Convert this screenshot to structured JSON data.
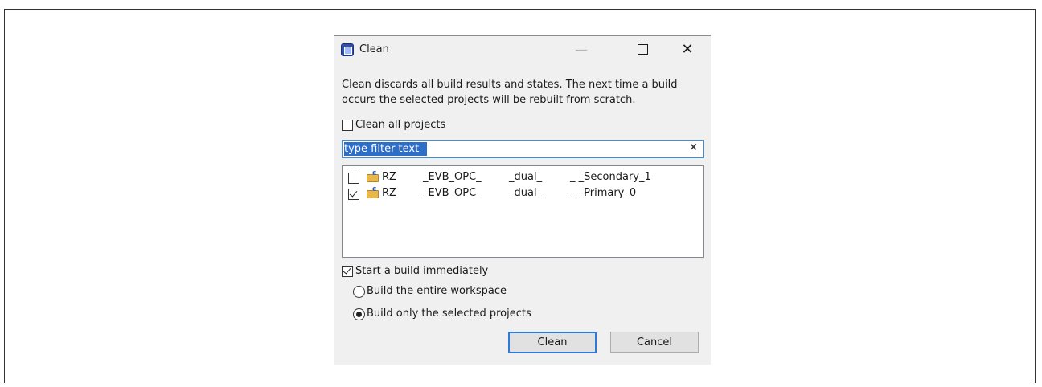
{
  "dialog": {
    "title": "Clean",
    "description_line1": "Clean discards all build results and states. The next time a build",
    "description_line2": "occurs the selected projects will be rebuilt from scratch.",
    "clean_all_label": "Clean all projects",
    "clean_all_checked": false,
    "filter": {
      "value": "type filter text",
      "clear_icon": "×"
    },
    "projects": [
      {
        "checked": false,
        "name_parts": [
          "RZ",
          "_EVB_OPC_",
          "_dual_",
          "_ _Secondary_1"
        ]
      },
      {
        "checked": true,
        "name_parts": [
          "RZ",
          "_EVB_OPC_",
          "_dual_",
          "_ _Primary_0"
        ]
      }
    ],
    "start_build_label": "Start a build immediately",
    "start_build_checked": true,
    "build_options": [
      {
        "label": "Build the entire workspace",
        "selected": false
      },
      {
        "label": "Build only the selected projects",
        "selected": true
      }
    ],
    "buttons": {
      "clean": "Clean",
      "cancel": "Cancel"
    }
  },
  "window_controls": {
    "minimize": "—",
    "close": "✕"
  },
  "colors": {
    "accent": "#2f7ad9",
    "selection": "#2d6ec8",
    "dialog_bg": "#f0f0f0"
  }
}
